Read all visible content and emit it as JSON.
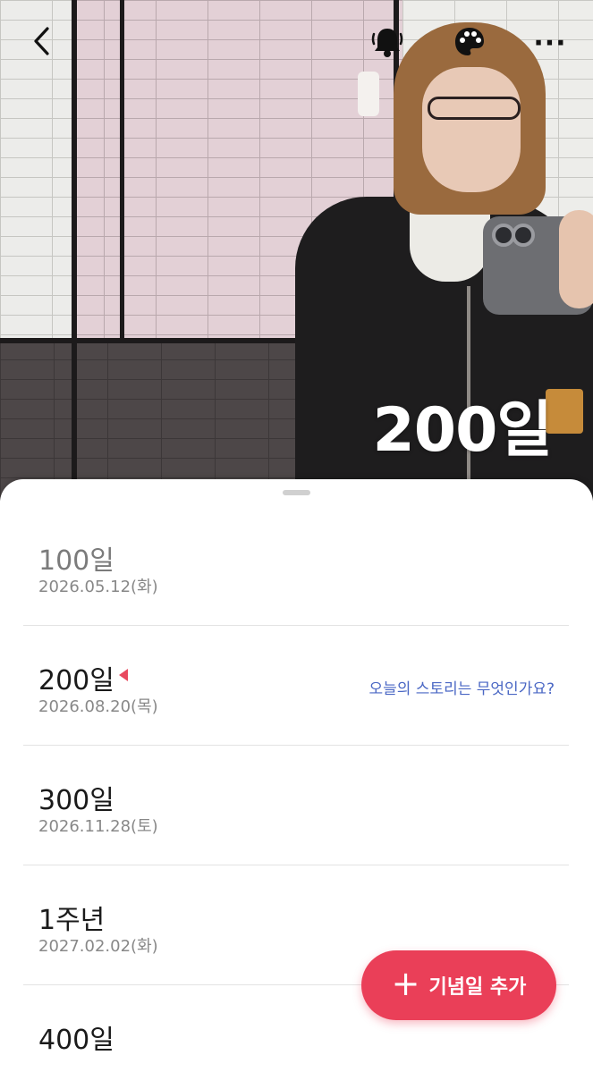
{
  "header": {
    "counter_text": "200일",
    "back_icon": "chevron-left-icon",
    "bell_icon": "bell-icon",
    "palette_icon": "palette-icon",
    "more_icon": "more-horizontal-icon",
    "more_label": "···"
  },
  "anniversaries": [
    {
      "title": "100일",
      "date": "2026.05.12(화)",
      "muted": true
    },
    {
      "title": "200일",
      "date": "2026.08.20(목)",
      "today": true,
      "story_prompt": "오늘의 스토리는 무엇인가요?"
    },
    {
      "title": "300일",
      "date": "2026.11.28(토)"
    },
    {
      "title": "1주년",
      "date": "2027.02.02(화)"
    },
    {
      "title": "400일",
      "date": ""
    }
  ],
  "fab": {
    "plus": "+",
    "label": "기념일 추가",
    "color": "#ea3f58"
  },
  "colors": {
    "accent": "#ea3f58",
    "link": "#4a67c4",
    "today_marker": "#e84a5f"
  }
}
